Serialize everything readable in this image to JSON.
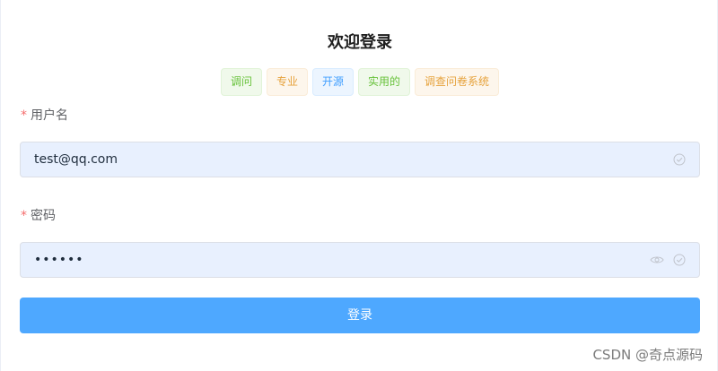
{
  "title": "欢迎登录",
  "tags": [
    {
      "label": "调问",
      "type": "success"
    },
    {
      "label": "专业",
      "type": "warning"
    },
    {
      "label": "开源",
      "type": "info"
    },
    {
      "label": "实用的",
      "type": "success"
    },
    {
      "label": "调查问卷系统",
      "type": "warning"
    }
  ],
  "form": {
    "username_label": "用户名",
    "username_value": "test@qq.com",
    "password_label": "密码",
    "password_value": "••••••",
    "required_mark": "*"
  },
  "login_button": "登录",
  "watermark": "CSDN @奇点源码",
  "icons": {
    "check": "circle-check-icon",
    "eye": "eye-icon"
  },
  "colors": {
    "primary": "#4ea8ff",
    "required": "#f56c6c",
    "autofill_bg": "#e8f0fe"
  }
}
